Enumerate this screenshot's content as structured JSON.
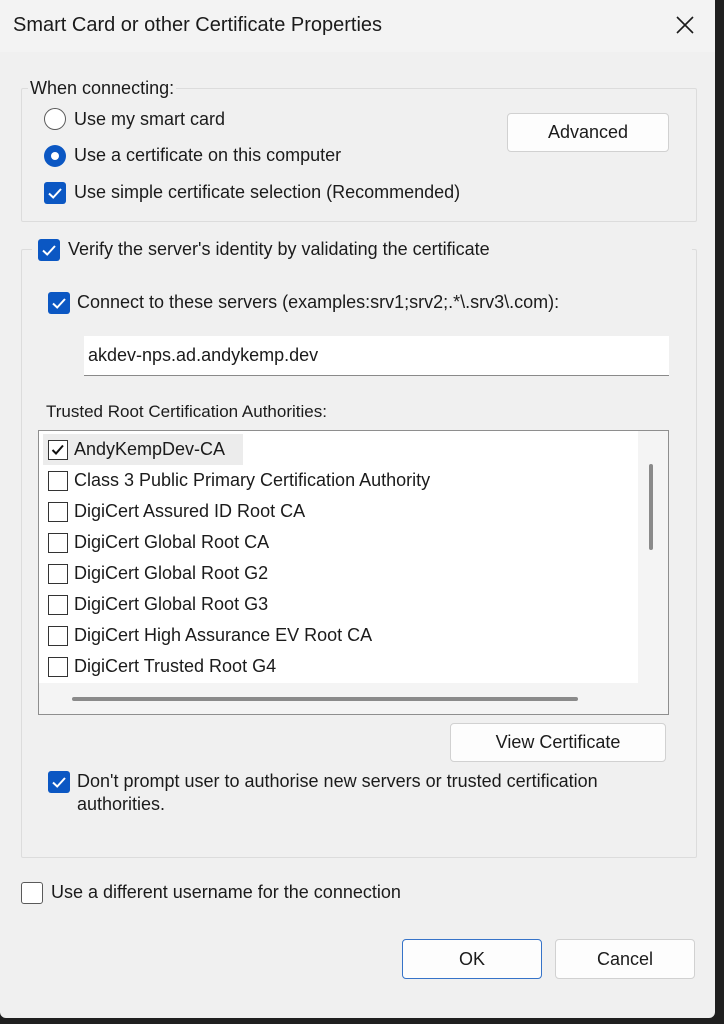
{
  "window": {
    "title": "Smart Card or other Certificate Properties",
    "close_icon": "close-icon"
  },
  "connecting": {
    "legend": "When connecting:",
    "radio_smart_card": {
      "label": "Use my smart card",
      "selected": false
    },
    "radio_certificate": {
      "label": "Use a certificate on this computer",
      "selected": true
    },
    "simple_selection": {
      "label": "Use simple certificate selection (Recommended)",
      "checked": true
    },
    "advanced_button": "Advanced"
  },
  "verify": {
    "label": "Verify the server's identity by validating the certificate",
    "checked": true,
    "connect_servers": {
      "label": "Connect to these servers (examples:srv1;srv2;.*\\.srv3\\.com):",
      "checked": true,
      "value": "akdev-nps.ad.andykemp.dev"
    },
    "trusted_roots_label": "Trusted Root Certification Authorities:",
    "trusted_roots": [
      {
        "name": "AndyKempDev-CA",
        "checked": true,
        "selected": true
      },
      {
        "name": "Class 3 Public Primary Certification Authority",
        "checked": false
      },
      {
        "name": "DigiCert Assured ID Root CA",
        "checked": false
      },
      {
        "name": "DigiCert Global Root CA",
        "checked": false
      },
      {
        "name": "DigiCert Global Root G2",
        "checked": false
      },
      {
        "name": "DigiCert Global Root G3",
        "checked": false
      },
      {
        "name": "DigiCert High Assurance EV Root CA",
        "checked": false
      },
      {
        "name": "DigiCert Trusted Root G4",
        "checked": false
      }
    ],
    "view_certificate_button": "View Certificate",
    "dont_prompt": {
      "line1": "Don't prompt user to authorise new servers or trusted certification",
      "line2": "authorities.",
      "checked": true
    }
  },
  "different_username": {
    "label": "Use a different username for the connection",
    "checked": false
  },
  "footer": {
    "ok_button": "OK",
    "cancel_button": "Cancel"
  },
  "colors": {
    "accent": "#0b57c3",
    "dialog_bg": "#f0f0f0",
    "outer_bg": "#1f1f1f"
  }
}
